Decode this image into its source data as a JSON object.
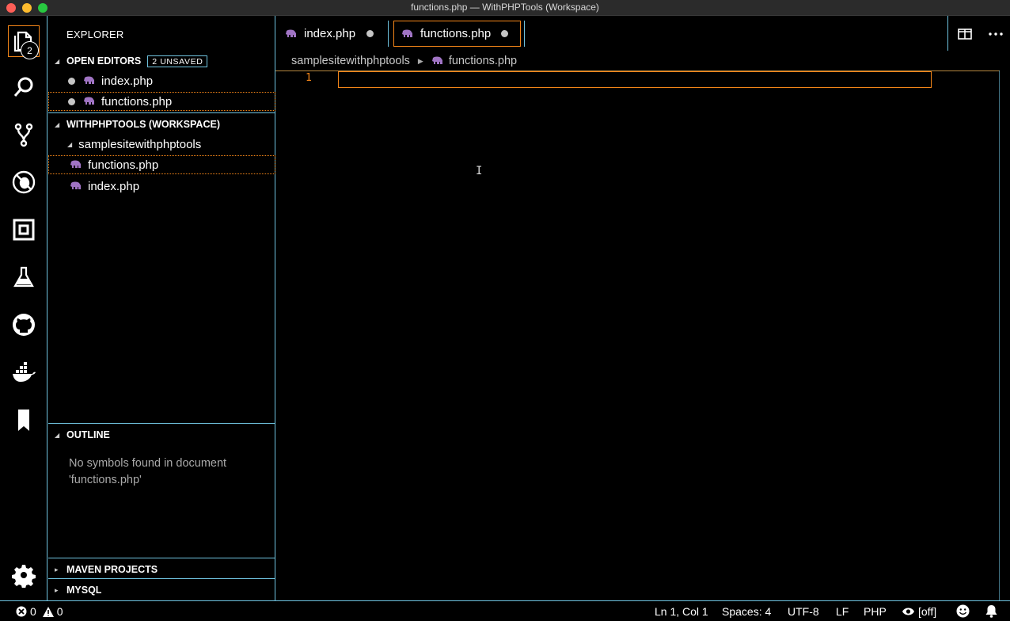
{
  "window": {
    "title": "functions.php — WithPHPTools (Workspace)"
  },
  "activity_bar": {
    "items": [
      "explorer-icon",
      "search-icon",
      "source-control-icon",
      "debug-icon",
      "extensions-icon",
      "test-flask-icon",
      "github-icon",
      "docker-icon",
      "bookmark-icon",
      "settings-gear-icon"
    ],
    "explorer_badge": "2"
  },
  "sidebar": {
    "title": "EXPLORER",
    "open_editors": {
      "header": "OPEN EDITORS",
      "badge": "2 UNSAVED",
      "items": [
        {
          "label": "index.php"
        },
        {
          "label": "functions.php"
        }
      ]
    },
    "workspace": {
      "header": "WITHPHPTOOLS (WORKSPACE)",
      "folder": "samplesitewithphptools",
      "files": [
        {
          "label": "functions.php"
        },
        {
          "label": "index.php"
        }
      ]
    },
    "outline": {
      "header": "OUTLINE",
      "empty_line1": "No symbols found in document",
      "empty_line2": "'functions.php'"
    },
    "maven": {
      "header": "MAVEN PROJECTS"
    },
    "mysql": {
      "header": "MYSQL"
    }
  },
  "tabs": [
    {
      "label": "index.php",
      "dirty": true
    },
    {
      "label": "functions.php",
      "dirty": true,
      "active": true
    }
  ],
  "breadcrumb": {
    "folder": "samplesitewithphptools",
    "file": "functions.php"
  },
  "editor": {
    "line_numbers": [
      "1"
    ]
  },
  "status": {
    "errors": "0",
    "warnings": "0",
    "position": "Ln 1, Col 1",
    "indent": "Spaces: 4",
    "encoding": "UTF-8",
    "eol": "LF",
    "language": "PHP",
    "live_server": "[off]"
  },
  "colors": {
    "contrast_border": "#6fc3df",
    "active_border": "#f38518",
    "php_icon": "#a074c4"
  }
}
